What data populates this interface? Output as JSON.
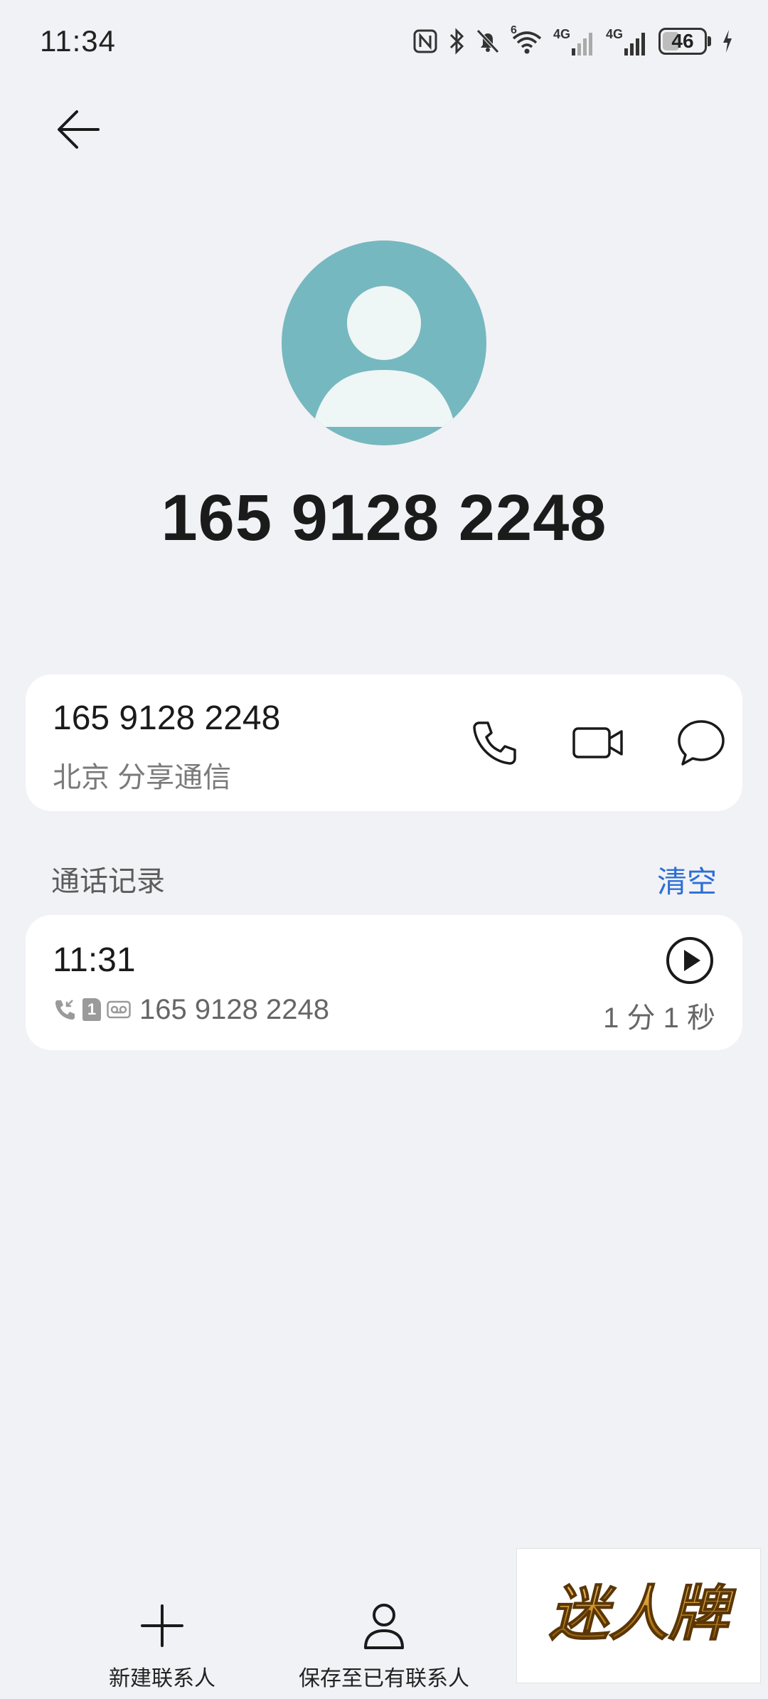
{
  "status_bar": {
    "time": "11:34",
    "battery_level": "46",
    "network_1": "4G",
    "network_2": "4G",
    "wifi_badge": "6"
  },
  "header": {
    "back_icon": "arrow-left-icon"
  },
  "contact": {
    "title": "165 9128 2248",
    "number": "165 9128 2248",
    "location": "北京 分享通信",
    "avatar_color": "#76b8bf",
    "actions": [
      "phone-icon",
      "video-call-icon",
      "message-icon"
    ]
  },
  "call_log": {
    "section_title": "通话记录",
    "clear_label": "清空",
    "accent_color": "#2c6fd6",
    "records": [
      {
        "time": "11:31",
        "sim_badge": "1",
        "number": "165 9128 2248",
        "duration": "1 分 1 秒"
      }
    ]
  },
  "bottom_bar": {
    "new_contact_label": "新建联系人",
    "save_existing_label": "保存至已有联系人"
  },
  "watermark": {
    "text": "迷人牌"
  }
}
